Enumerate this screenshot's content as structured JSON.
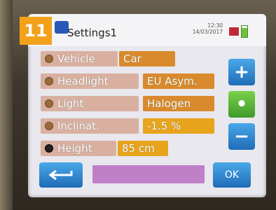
{
  "badge": "11",
  "header": {
    "title": "Settings1",
    "time": "12:30",
    "date": "14/03/2017"
  },
  "rows": [
    {
      "label": "Vehicle",
      "value": "Car",
      "selected": false
    },
    {
      "label": "Headlight",
      "value": "EU Asym.",
      "selected": false
    },
    {
      "label": "Light",
      "value": "Halogen",
      "selected": false
    },
    {
      "label": "Inclinat.",
      "value": "-1.5 %",
      "selected": false
    },
    {
      "label": "Height",
      "value": "85 cm",
      "selected": true
    }
  ],
  "buttons": {
    "plus": "+",
    "dot": "•",
    "minus": "−",
    "ok": "OK"
  },
  "colors": {
    "label_bg": "#d9b0a0",
    "value_bg": "#d98a2c",
    "blue_button": "#1f6cb8",
    "green_button": "#3f9a2a",
    "bottom_field": "#c080c8"
  }
}
